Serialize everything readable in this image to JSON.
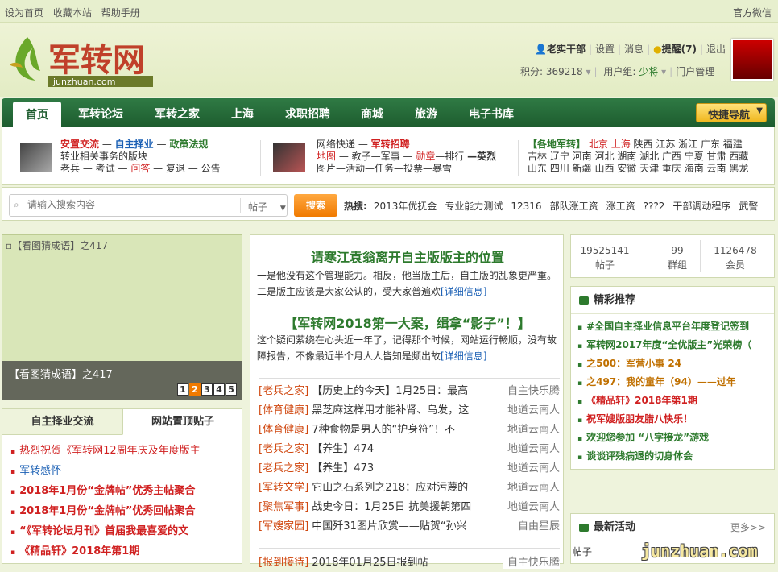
{
  "topbar": {
    "home": "设为首页",
    "fav": "收藏本站",
    "help": "帮助手册",
    "wechat": "官方微信"
  },
  "logo": {
    "text": "军转网",
    "domain": "junzhuan.com"
  },
  "user": {
    "name": "老实干部",
    "settings": "设置",
    "messages": "消息",
    "remind": "提醒(7)",
    "logout": "退出",
    "points_label": "积分: 369218",
    "group_label": "用户组:",
    "group": "少将",
    "portal": "门户管理"
  },
  "nav": {
    "items": [
      "首页",
      "军转论坛",
      "军转之家",
      "上海",
      "求职招聘",
      "商城",
      "旅游",
      "电子书库"
    ],
    "quick": "快捷导航"
  },
  "subnav": {
    "b1": {
      "l1a": "安置交流",
      "l1b": "自主择业",
      "l1c": "政策法规",
      "l2": "转业相关事务的版块",
      "l3a": "老兵",
      "l3b": "考试",
      "l3c": "问答",
      "l3d": "复退",
      "l3e": "公告"
    },
    "b2": {
      "l1a": "网络快递",
      "l1b": "军转招聘",
      "l2a": "地图",
      "l2b": "教子—军事",
      "l2c": "勋章",
      "l2d": "—排行",
      "l2e": "—英烈",
      "l3": "图片—活动—任务—投票—暴雪"
    },
    "b3": {
      "l1a": "【各地军转】",
      "l1b": "北京",
      "l1c": "上海",
      "l1d": "陕西 江苏 浙江 广东 福建",
      "l2": "吉林 辽宁 河南 河北 湖南 湖北 广西 宁夏 甘肃 西藏",
      "l3": "山东 四川 新疆 山西 安徽 天津 重庆 海南 云南 黑龙"
    }
  },
  "search": {
    "placeholder": "请输入搜索内容",
    "type": "帖子",
    "button": "搜索",
    "hot_label": "热搜:",
    "hot": [
      "2013年优抚金",
      "专业能力测试",
      "12316",
      "部队涨工资",
      "涨工资",
      "???2",
      "干部调动程序",
      "武警"
    ]
  },
  "slider": {
    "alt": "【看图猜成语】之417",
    "caption": "【看图猜成语】之417",
    "pages": [
      "1",
      "2",
      "3",
      "4",
      "5"
    ]
  },
  "tabs": {
    "t1": "自主择业交流",
    "t2": "网站置顶贴子",
    "items": [
      "热烈祝贺《军转网12周年庆及年度版主",
      "军转感怀",
      "2018年1月份“金牌帖”优秀主帖聚合",
      "2018年1月份“金牌帖”优秀回帖聚合",
      "“《军转论坛月刊》首届我最喜爱的文",
      "《精品轩》2018年第1期"
    ]
  },
  "center": {
    "t1": "请寒江袁翁离开自主版版主的位置",
    "p1": "一是他没有这个管理能力。相反，他当版主后，自主版的乱象更严重。二是版主应该是大家公认的，受大家普遍欢",
    "p1more": "[详细信息]",
    "t2": "【军转网2018第一大案，缉拿“影子”！】",
    "p2": "这个疑问萦绕在心头近一年了，记得那个时候，网站运行畅顺，没有故障报告，不像最近半个月人人皆知是频出故",
    "p2more": "[详细信息]",
    "rows": [
      {
        "cat": "[老兵之家]",
        "title": "【历史上的今天】1月25日：最高",
        "au": "自主快乐腾"
      },
      {
        "cat": "[体育健康]",
        "title": "黑芝麻这样用才能补肾、乌发，这",
        "au": "地道云南人"
      },
      {
        "cat": "[体育健康]",
        "title": "7种食物是男人的“护身符”！不",
        "au": "地道云南人"
      },
      {
        "cat": "[老兵之家]",
        "title": "【养生】474",
        "au": "地道云南人"
      },
      {
        "cat": "[老兵之家]",
        "title": "【养生】473",
        "au": "地道云南人"
      },
      {
        "cat": "[军转文学]",
        "title": "它山之石系列之218：应对污蔑的",
        "au": "地道云南人"
      },
      {
        "cat": "[聚焦军事]",
        "title": "战史今日：1月25日 抗美援朝第四",
        "au": "地道云南人"
      },
      {
        "cat": "[军嫂家园]",
        "title": "中国歼31图片欣赏——贴贺“孙兴",
        "au": "自由星辰"
      },
      {
        "cat": "[报到接待]",
        "title": "2018年01月25日报到帖",
        "au": "自主快乐腾"
      }
    ]
  },
  "stats": {
    "posts": "19525141",
    "posts_label": "帖子",
    "groups": "99",
    "groups_label": "群组",
    "members": "1126478",
    "members_label": "会员"
  },
  "rec": {
    "title": "精彩推荐",
    "items": [
      "#全国自主择业信息平台年度登记签到",
      "军转网2017年度“全优版主”光荣榜（",
      "之500：军营小事 24",
      "之497：我的童年（94）——过年",
      "《精品轩》2018年第1期",
      "祝军嫂版朋友腊八快乐！",
      "欢迎您参加 “八字接龙”游戏",
      "谈谈评残病退的切身体会"
    ],
    "colors": [
      "#2d7a2d",
      "#2d7a2d",
      "#c07000",
      "#c07000",
      "#d02020",
      "#d02020",
      "#2d7a2d",
      "#2d7a2d"
    ]
  },
  "act": {
    "title": "最新活动",
    "more": "更多>>",
    "first": "帖子"
  },
  "watermark": "junzhuan.com"
}
